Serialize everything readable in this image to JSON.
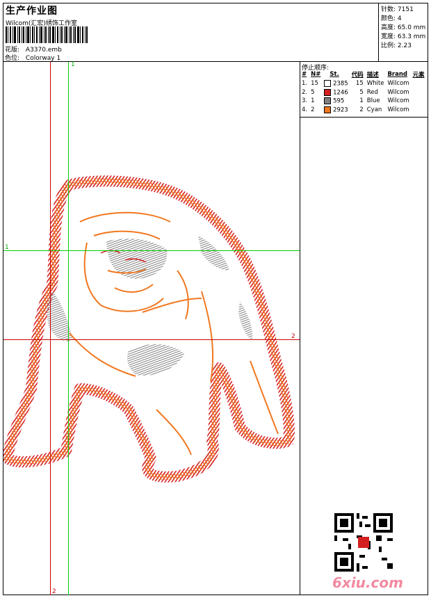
{
  "header": {
    "title": "生产作业图",
    "subtitle": "Wilcom(汇宏)绣饰工作室",
    "design_label": "花版:",
    "design_value": "A3370.emb",
    "colorway_label": "色位:",
    "colorway_value": "Colorway 1"
  },
  "stats": {
    "stitches": "针数: 7151",
    "colors": "颜色: 4",
    "height": "高度: 65.0 mm",
    "width": "宽度: 63.3 mm",
    "ratio": "比例: 2.23"
  },
  "stop_sequence": {
    "title": "停止顺序:",
    "headers": [
      "#",
      "N#",
      "St.",
      "代码",
      "描述",
      "Brand",
      "元素"
    ],
    "rows": [
      {
        "num": "1.",
        "needle": "15",
        "swatch": "#ffffff",
        "stitches": "2385",
        "code": "15",
        "desc": "White",
        "brand": "Wilcom"
      },
      {
        "num": "2.",
        "needle": "5",
        "swatch": "#d42020",
        "stitches": "1246",
        "code": "5",
        "desc": "Red",
        "brand": "Wilcom"
      },
      {
        "num": "3.",
        "needle": "1",
        "swatch": "#808080",
        "stitches": "595",
        "code": "1",
        "desc": "Blue",
        "brand": "Wilcom"
      },
      {
        "num": "4.",
        "needle": "2",
        "swatch": "#f07820",
        "stitches": "2923",
        "code": "2",
        "desc": "Cyan",
        "brand": "Wilcom"
      }
    ]
  },
  "guides": {
    "green_vertical_label": "1",
    "green_horizontal_label": "1",
    "red_horizontal_label": "2",
    "red_vertical_label": "2"
  },
  "colors": {
    "green_guide": "#00cc00",
    "red_guide": "#cc0000",
    "thread_orange": "#f07820",
    "thread_red": "#d42020",
    "thread_gray": "#808080"
  },
  "icons": {
    "design": "bulldog-embroidery-icon",
    "barcode": "barcode-icon",
    "qr": "qr-code-icon"
  },
  "watermark": "6xiu.com"
}
